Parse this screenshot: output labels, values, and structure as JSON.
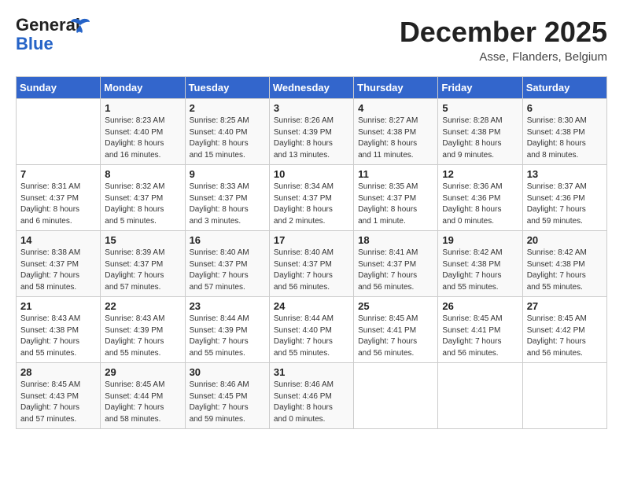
{
  "logo": {
    "line1": "General",
    "line2": "Blue"
  },
  "header": {
    "month": "December 2025",
    "location": "Asse, Flanders, Belgium"
  },
  "weekdays": [
    "Sunday",
    "Monday",
    "Tuesday",
    "Wednesday",
    "Thursday",
    "Friday",
    "Saturday"
  ],
  "weeks": [
    [
      {
        "day": "",
        "info": ""
      },
      {
        "day": "1",
        "info": "Sunrise: 8:23 AM\nSunset: 4:40 PM\nDaylight: 8 hours\nand 16 minutes."
      },
      {
        "day": "2",
        "info": "Sunrise: 8:25 AM\nSunset: 4:40 PM\nDaylight: 8 hours\nand 15 minutes."
      },
      {
        "day": "3",
        "info": "Sunrise: 8:26 AM\nSunset: 4:39 PM\nDaylight: 8 hours\nand 13 minutes."
      },
      {
        "day": "4",
        "info": "Sunrise: 8:27 AM\nSunset: 4:38 PM\nDaylight: 8 hours\nand 11 minutes."
      },
      {
        "day": "5",
        "info": "Sunrise: 8:28 AM\nSunset: 4:38 PM\nDaylight: 8 hours\nand 9 minutes."
      },
      {
        "day": "6",
        "info": "Sunrise: 8:30 AM\nSunset: 4:38 PM\nDaylight: 8 hours\nand 8 minutes."
      }
    ],
    [
      {
        "day": "7",
        "info": "Sunrise: 8:31 AM\nSunset: 4:37 PM\nDaylight: 8 hours\nand 6 minutes."
      },
      {
        "day": "8",
        "info": "Sunrise: 8:32 AM\nSunset: 4:37 PM\nDaylight: 8 hours\nand 5 minutes."
      },
      {
        "day": "9",
        "info": "Sunrise: 8:33 AM\nSunset: 4:37 PM\nDaylight: 8 hours\nand 3 minutes."
      },
      {
        "day": "10",
        "info": "Sunrise: 8:34 AM\nSunset: 4:37 PM\nDaylight: 8 hours\nand 2 minutes."
      },
      {
        "day": "11",
        "info": "Sunrise: 8:35 AM\nSunset: 4:37 PM\nDaylight: 8 hours\nand 1 minute."
      },
      {
        "day": "12",
        "info": "Sunrise: 8:36 AM\nSunset: 4:36 PM\nDaylight: 8 hours\nand 0 minutes."
      },
      {
        "day": "13",
        "info": "Sunrise: 8:37 AM\nSunset: 4:36 PM\nDaylight: 7 hours\nand 59 minutes."
      }
    ],
    [
      {
        "day": "14",
        "info": "Sunrise: 8:38 AM\nSunset: 4:37 PM\nDaylight: 7 hours\nand 58 minutes."
      },
      {
        "day": "15",
        "info": "Sunrise: 8:39 AM\nSunset: 4:37 PM\nDaylight: 7 hours\nand 57 minutes."
      },
      {
        "day": "16",
        "info": "Sunrise: 8:40 AM\nSunset: 4:37 PM\nDaylight: 7 hours\nand 57 minutes."
      },
      {
        "day": "17",
        "info": "Sunrise: 8:40 AM\nSunset: 4:37 PM\nDaylight: 7 hours\nand 56 minutes."
      },
      {
        "day": "18",
        "info": "Sunrise: 8:41 AM\nSunset: 4:37 PM\nDaylight: 7 hours\nand 56 minutes."
      },
      {
        "day": "19",
        "info": "Sunrise: 8:42 AM\nSunset: 4:38 PM\nDaylight: 7 hours\nand 55 minutes."
      },
      {
        "day": "20",
        "info": "Sunrise: 8:42 AM\nSunset: 4:38 PM\nDaylight: 7 hours\nand 55 minutes."
      }
    ],
    [
      {
        "day": "21",
        "info": "Sunrise: 8:43 AM\nSunset: 4:38 PM\nDaylight: 7 hours\nand 55 minutes."
      },
      {
        "day": "22",
        "info": "Sunrise: 8:43 AM\nSunset: 4:39 PM\nDaylight: 7 hours\nand 55 minutes."
      },
      {
        "day": "23",
        "info": "Sunrise: 8:44 AM\nSunset: 4:39 PM\nDaylight: 7 hours\nand 55 minutes."
      },
      {
        "day": "24",
        "info": "Sunrise: 8:44 AM\nSunset: 4:40 PM\nDaylight: 7 hours\nand 55 minutes."
      },
      {
        "day": "25",
        "info": "Sunrise: 8:45 AM\nSunset: 4:41 PM\nDaylight: 7 hours\nand 56 minutes."
      },
      {
        "day": "26",
        "info": "Sunrise: 8:45 AM\nSunset: 4:41 PM\nDaylight: 7 hours\nand 56 minutes."
      },
      {
        "day": "27",
        "info": "Sunrise: 8:45 AM\nSunset: 4:42 PM\nDaylight: 7 hours\nand 56 minutes."
      }
    ],
    [
      {
        "day": "28",
        "info": "Sunrise: 8:45 AM\nSunset: 4:43 PM\nDaylight: 7 hours\nand 57 minutes."
      },
      {
        "day": "29",
        "info": "Sunrise: 8:45 AM\nSunset: 4:44 PM\nDaylight: 7 hours\nand 58 minutes."
      },
      {
        "day": "30",
        "info": "Sunrise: 8:46 AM\nSunset: 4:45 PM\nDaylight: 7 hours\nand 59 minutes."
      },
      {
        "day": "31",
        "info": "Sunrise: 8:46 AM\nSunset: 4:46 PM\nDaylight: 8 hours\nand 0 minutes."
      },
      {
        "day": "",
        "info": ""
      },
      {
        "day": "",
        "info": ""
      },
      {
        "day": "",
        "info": ""
      }
    ]
  ]
}
